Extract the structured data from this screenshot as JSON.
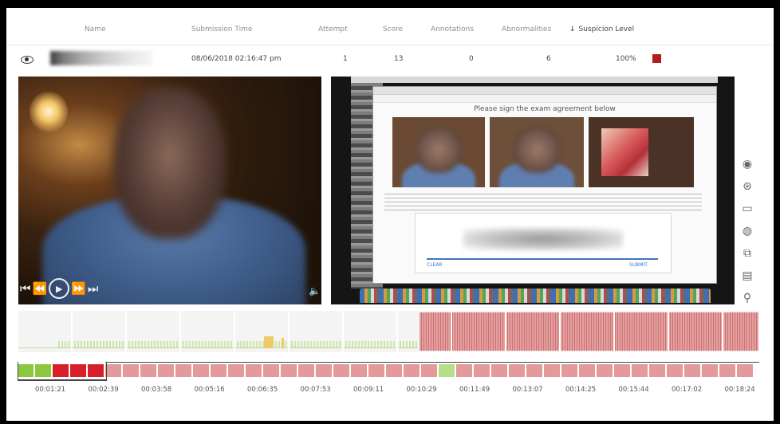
{
  "table": {
    "headers": {
      "name": "Name",
      "submission_time": "Submission Time",
      "attempt": "Attempt",
      "score": "Score",
      "annotations": "Annotations",
      "abnormalities": "Abnormalities",
      "suspicion_level": "Suspicion Level"
    },
    "sort_icon": "arrow-down-icon",
    "row": {
      "submission_time": "08/06/2018 02:16:47 pm",
      "attempt": "1",
      "score": "13",
      "annotations": "0",
      "abnormalities": "6",
      "suspicion": "100%",
      "suspicion_color": "#b41d1d"
    }
  },
  "video": {
    "controls": [
      "rewind-icon",
      "step-back-icon",
      "play-icon",
      "step-forward-icon",
      "fast-forward-icon"
    ],
    "volume_icon": "speaker-icon"
  },
  "screen_capture": {
    "heading": "Please sign the exam agreement below",
    "clear_label": "CLEAR",
    "submit_label": "SUBMIT"
  },
  "side_icons": [
    "webcam-icon",
    "chat-alert-icon",
    "monitor-icon",
    "globe-icon",
    "share-icon",
    "calendar-icon",
    "person-icon"
  ],
  "timeline": {
    "segments": [
      "green",
      "green",
      "red",
      "red",
      "red",
      "pink",
      "pink",
      "pink",
      "pink",
      "pink",
      "pink",
      "pink",
      "pink",
      "pink",
      "pink",
      "pink",
      "pink",
      "pink",
      "pink",
      "pink",
      "pink",
      "pink",
      "pink",
      "pink",
      "lgreen",
      "pink",
      "pink",
      "pink",
      "pink",
      "pink",
      "pink",
      "pink",
      "pink",
      "pink",
      "pink",
      "pink",
      "pink",
      "pink",
      "pink",
      "pink",
      "pink",
      "pink"
    ],
    "ticks": [
      "00:01:21",
      "00:02:39",
      "00:03:58",
      "00:05:16",
      "00:06:35",
      "00:07:53",
      "00:09:11",
      "00:10:29",
      "00:11:49",
      "00:13:07",
      "00:14:25",
      "00:15:44",
      "00:17:02",
      "00:18:24"
    ],
    "colors": {
      "green": "#8dc63f",
      "red": "#d9202a",
      "pink": "#e39a9a",
      "lgreen": "#b5df86"
    }
  }
}
